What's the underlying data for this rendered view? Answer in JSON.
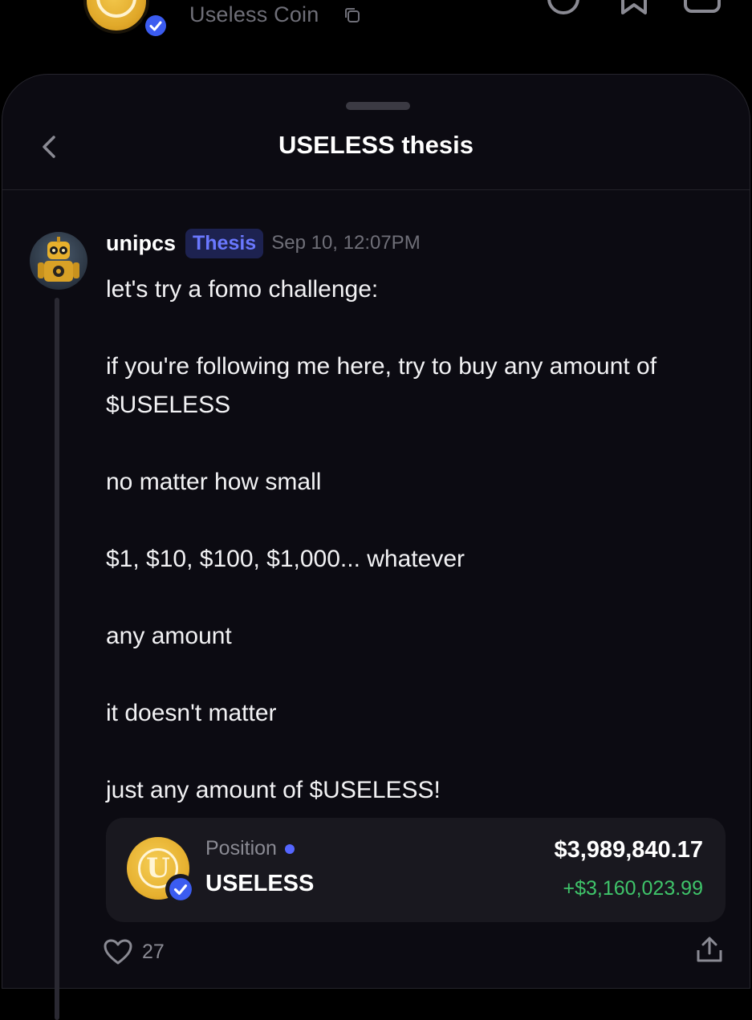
{
  "header": {
    "coin_name": "Useless Coin"
  },
  "sheet": {
    "title": "USELESS thesis"
  },
  "post": {
    "username": "unipcs",
    "tag": "Thesis",
    "timestamp": "Sep 10, 12:07PM",
    "paragraphs": [
      "let's try a fomo challenge:",
      "if you're following me here, try to buy any amount of $USELESS",
      "no matter how small",
      "$1, $10, $100, $1,000... whatever",
      "any amount",
      "it doesn't matter",
      "just any amount of $USELESS!"
    ]
  },
  "position": {
    "label": "Position",
    "coin_letter": "U",
    "token": "USELESS",
    "value": "$3,989,840.17",
    "gain": "+$3,160,023.99"
  },
  "actions": {
    "like_count": "27"
  },
  "colors": {
    "accent_blue": "#5566ff",
    "tag_bg": "#1d2250",
    "gain_green": "#3fc46a",
    "sheet_bg": "#0c0b12",
    "card_bg": "#19181f"
  },
  "icons": {
    "back": "chevron-left-icon",
    "copy": "copy-icon",
    "verified": "verified-badge-icon",
    "like": "heart-icon",
    "share": "share-icon"
  }
}
